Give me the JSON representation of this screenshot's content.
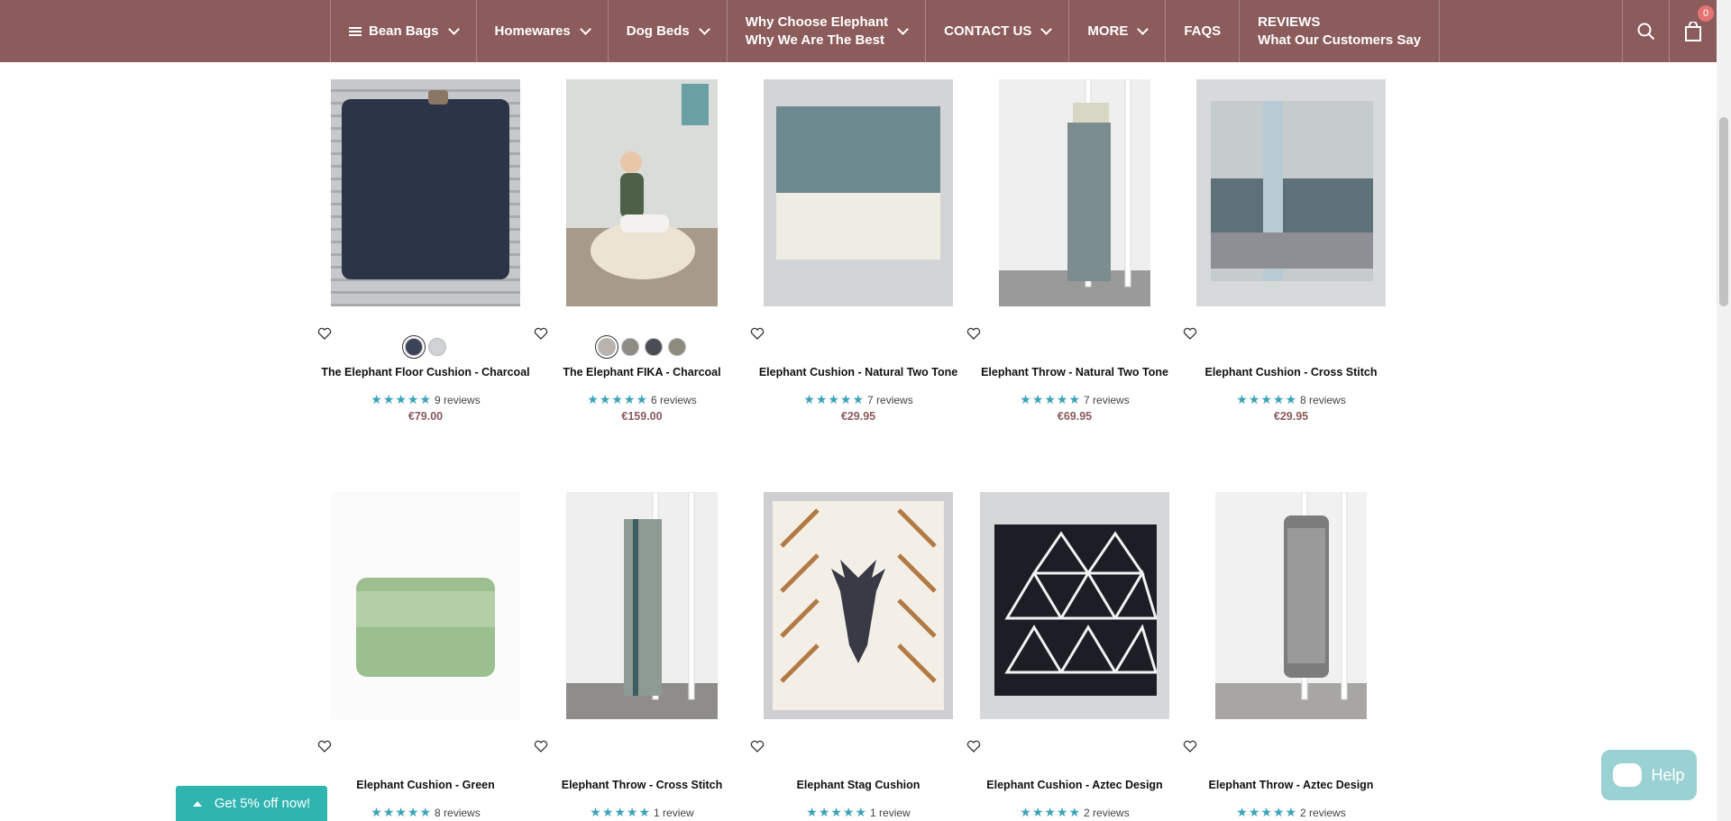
{
  "nav": {
    "items": [
      {
        "label": "Bean Bags",
        "has_menu_icon": true,
        "dropdown": true
      },
      {
        "label": "Homewares",
        "dropdown": true
      },
      {
        "label": "Dog Beds",
        "dropdown": true
      },
      {
        "label": "Why Choose Elephant",
        "sublabel": "Why We Are The Best",
        "dropdown": true
      },
      {
        "label": "CONTACT US",
        "dropdown": true
      },
      {
        "label": "MORE",
        "dropdown": true
      },
      {
        "label": "FAQS",
        "dropdown": false
      },
      {
        "label": "REVIEWS",
        "sublabel": "What Our Customers Say",
        "dropdown": false
      }
    ],
    "search_icon": "search-icon",
    "cart_icon": "shopping-bag-icon",
    "cart_count": "0"
  },
  "products": [
    {
      "name": "The Elephant Floor Cushion - Charcoal",
      "reviews": "9 reviews",
      "price": "€79.00",
      "swatches": [
        "#3b4358",
        "#cfd3d8"
      ]
    },
    {
      "name": "The Elephant FIKA - Charcoal",
      "reviews": "6 reviews",
      "price": "€159.00",
      "swatches": [
        "#b9b3ab",
        "#8f8b85",
        "#4a4d55",
        "#8e8a7e"
      ]
    },
    {
      "name": "Elephant Cushion - Natural Two Tone",
      "reviews": "7 reviews",
      "price": "€29.95",
      "swatches": []
    },
    {
      "name": "Elephant Throw - Natural Two Tone",
      "reviews": "7 reviews",
      "price": "€69.95",
      "swatches": []
    },
    {
      "name": "Elephant Cushion - Cross Stitch",
      "reviews": "8 reviews",
      "price": "€29.95",
      "swatches": []
    },
    {
      "name": "Elephant Cushion - Green",
      "reviews": "8 reviews",
      "price": "",
      "swatches": []
    },
    {
      "name": "Elephant Throw - Cross Stitch",
      "reviews": "1 review",
      "price": "",
      "swatches": []
    },
    {
      "name": "Elephant Stag Cushion",
      "reviews": "1 review",
      "price": "",
      "swatches": []
    },
    {
      "name": "Elephant Cushion - Aztec Design",
      "reviews": "2 reviews",
      "price": "",
      "swatches": []
    },
    {
      "name": "Elephant Throw - Aztec Design",
      "reviews": "2 reviews",
      "price": "",
      "swatches": []
    }
  ],
  "rating_stars": "★★★★★",
  "promo": {
    "label": "Get 5% off now!"
  },
  "help": {
    "label": "Help"
  },
  "colors": {
    "brand": "#8c5b5b",
    "star": "#3aa3b8",
    "promo": "#2fb4b0",
    "help": "#9ad2d3"
  }
}
